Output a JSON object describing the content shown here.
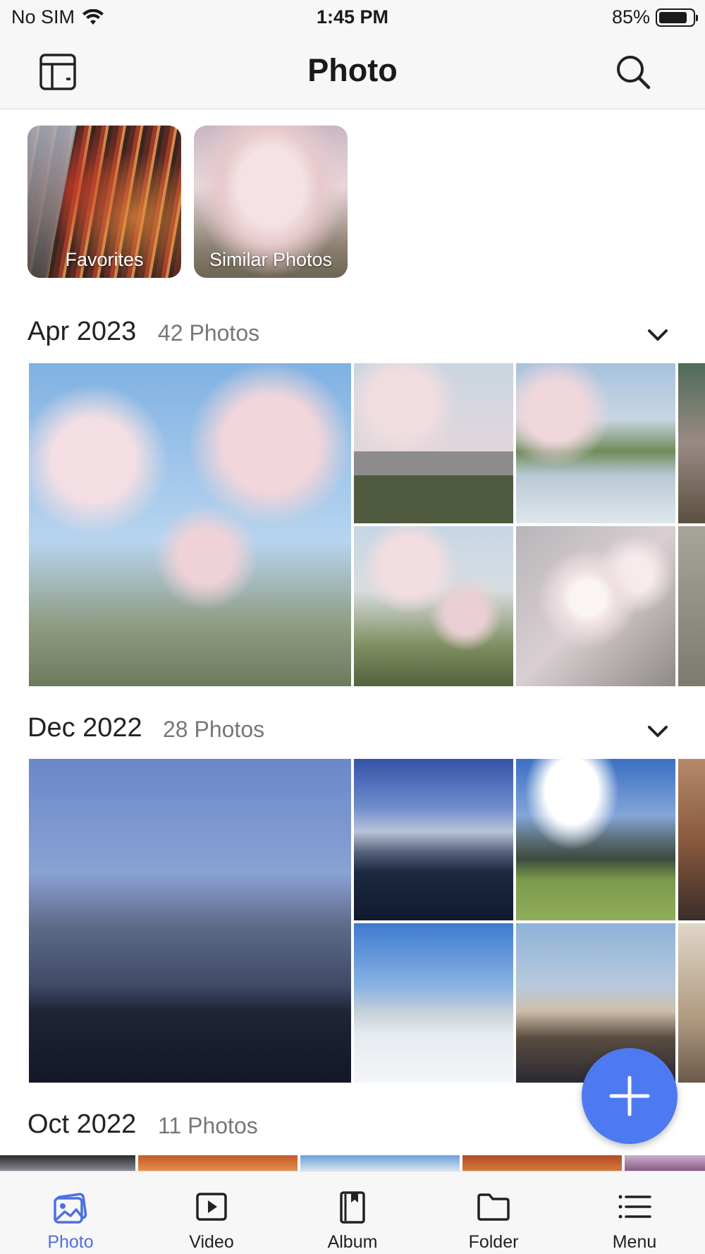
{
  "status": {
    "carrier": "No SIM",
    "time": "1:45 PM",
    "battery": "85%",
    "battery_level": 0.85
  },
  "nav": {
    "title": "Photo",
    "left_icon": "layout-panel-icon",
    "right_icon": "search-icon"
  },
  "shortcuts": [
    {
      "label": "Favorites"
    },
    {
      "label": "Similar Photos"
    }
  ],
  "sections": [
    {
      "date": "Apr 2023",
      "count": "42 Photos"
    },
    {
      "date": "Dec 2022",
      "count": "28 Photos"
    },
    {
      "date": "Oct 2022",
      "count": "11 Photos"
    }
  ],
  "tabs": [
    {
      "label": "Photo",
      "icon": "photo-icon",
      "active": true
    },
    {
      "label": "Video",
      "icon": "video-icon",
      "active": false
    },
    {
      "label": "Album",
      "icon": "album-icon",
      "active": false
    },
    {
      "label": "Folder",
      "icon": "folder-icon",
      "active": false
    },
    {
      "label": "Menu",
      "icon": "menu-icon",
      "active": false
    }
  ],
  "colors": {
    "accent": "#4d7af0",
    "active_tab": "#4d6fe0"
  }
}
